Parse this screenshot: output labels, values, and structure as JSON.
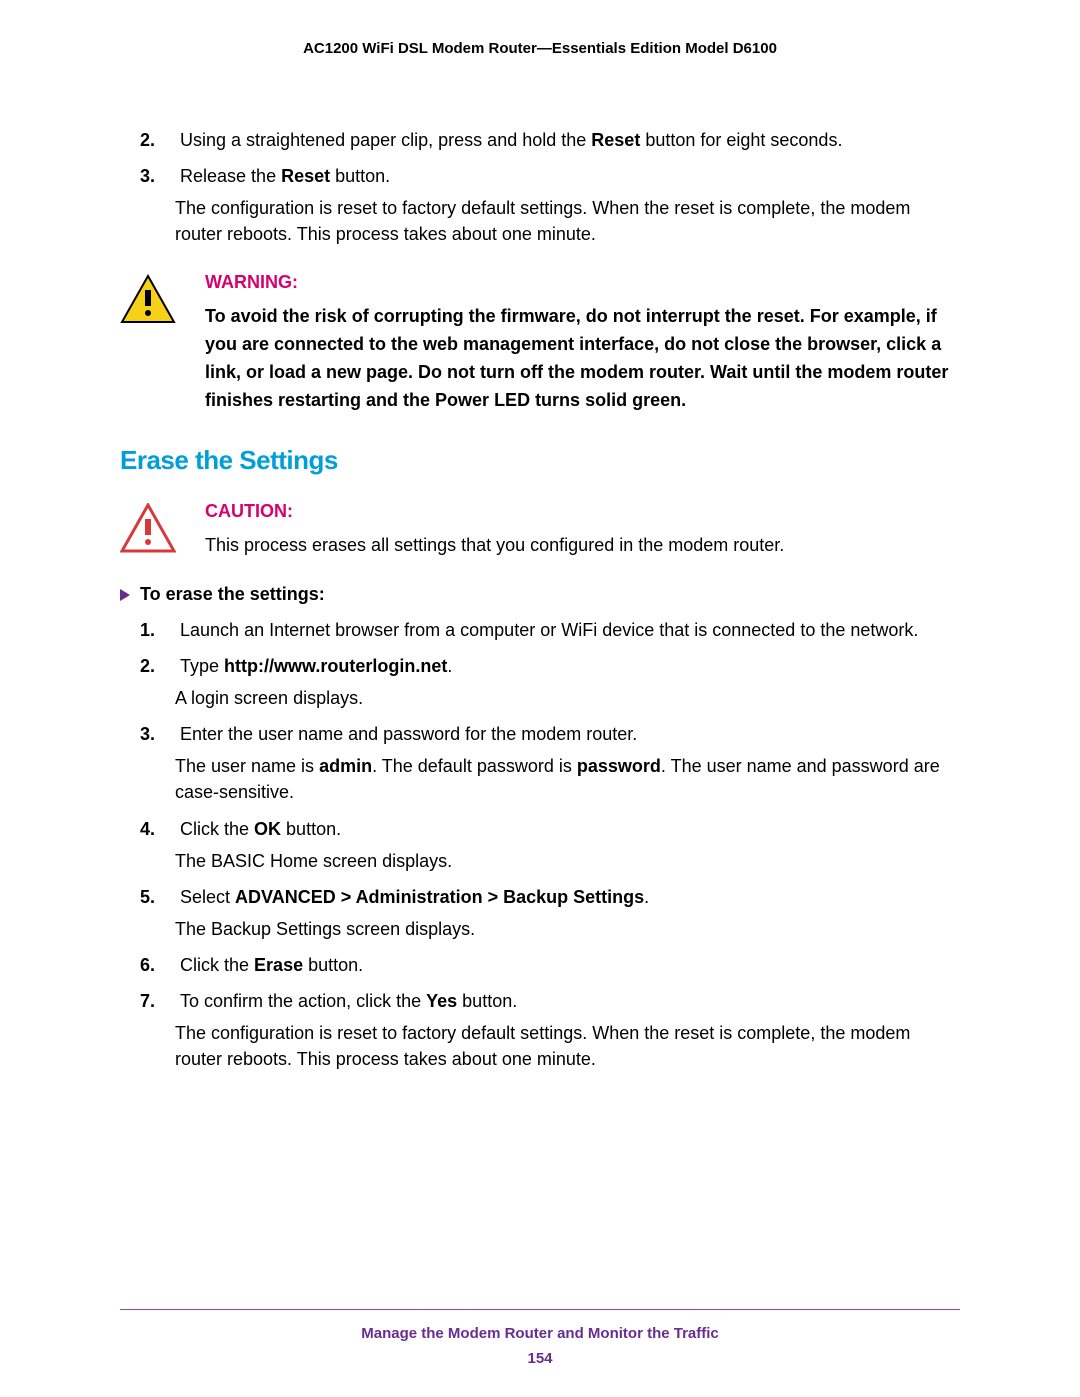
{
  "header": {
    "title": "AC1200 WiFi DSL Modem Router—Essentials Edition Model D6100"
  },
  "steps_top": [
    {
      "num": "2.",
      "pre": "Using a straightened paper clip, press and hold the ",
      "bold": "Reset",
      "post": " button for eight seconds."
    },
    {
      "num": "3.",
      "pre": "Release the ",
      "bold": "Reset",
      "post": " button."
    }
  ],
  "steps_top_after": "The configuration is reset to factory default settings. When the reset is complete, the modem router reboots. This process takes about one minute.",
  "warning": {
    "title": "WARNING:",
    "text": "To avoid the risk of corrupting the firmware, do not interrupt the reset. For example, if you are connected to the web management interface, do not close the browser, click a link, or load a new page. Do not turn off the modem router. Wait until the modem router finishes restarting and the Power LED turns solid green."
  },
  "section": {
    "title": "Erase the Settings"
  },
  "caution": {
    "title": "CAUTION:",
    "text": "This process erases all settings that you configured in the modem router."
  },
  "task": {
    "title": "To erase the settings:"
  },
  "steps": {
    "s1": {
      "num": "1.",
      "text": "Launch an Internet browser from a computer or WiFi device that is connected to the network."
    },
    "s2": {
      "num": "2.",
      "pre": "Type ",
      "bold": "http://www.routerlogin.net",
      "post": ".",
      "after": "A login screen displays."
    },
    "s3": {
      "num": "3.",
      "text": "Enter the user name and password for the modem router.",
      "after_pre": "The user name is ",
      "after_b1": "admin",
      "after_mid": ". The default password is ",
      "after_b2": "password",
      "after_post": ". The user name and password are case-sensitive."
    },
    "s4": {
      "num": "4.",
      "pre": "Click the ",
      "bold": "OK",
      "post": " button.",
      "after": "The BASIC Home screen displays."
    },
    "s5": {
      "num": "5.",
      "pre": "Select ",
      "bold": "ADVANCED > Administration > Backup Settings",
      "post": ".",
      "after": "The Backup Settings screen displays."
    },
    "s6": {
      "num": "6.",
      "pre": "Click the ",
      "bold": "Erase",
      "post": " button."
    },
    "s7": {
      "num": "7.",
      "pre": "To confirm the action, click the ",
      "bold": "Yes",
      "post": " button.",
      "after": "The configuration is reset to factory default settings. When the reset is complete, the modem router reboots. This process takes about one minute."
    }
  },
  "footer": {
    "title": "Manage the Modem Router and Monitor the Traffic",
    "page": "154"
  }
}
